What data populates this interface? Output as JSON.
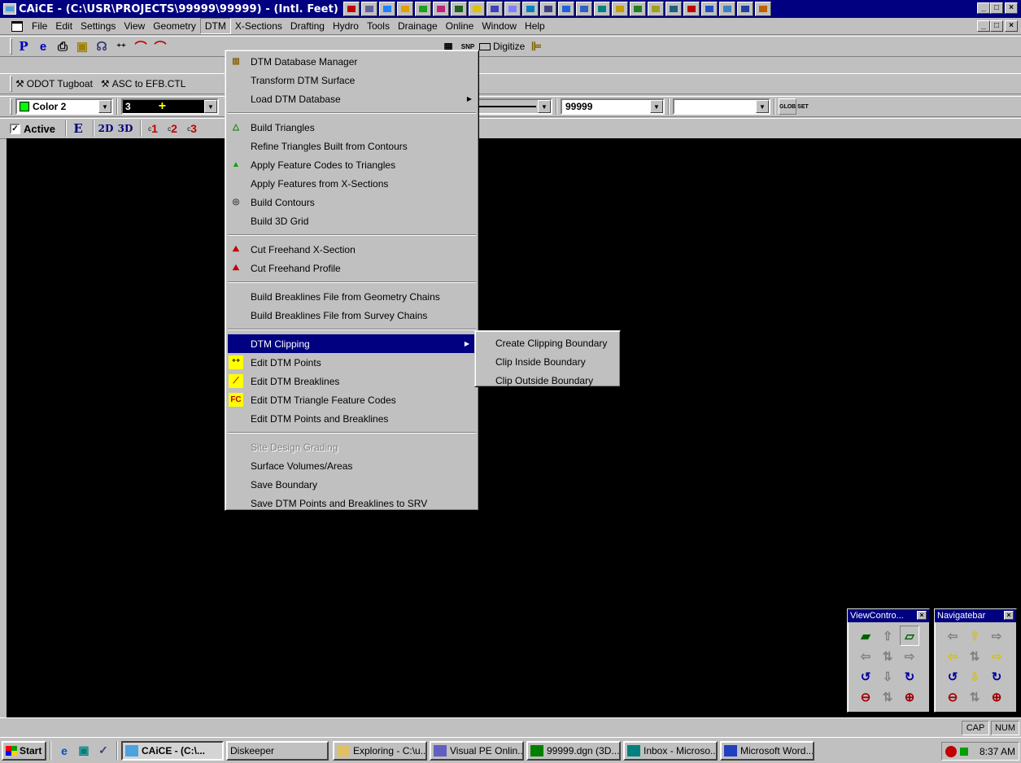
{
  "window": {
    "title": "CAiCE - (C:\\USR\\PROJECTS\\99999\\99999) - (Intl. Feet)",
    "controls": [
      "_",
      "□",
      "×"
    ]
  },
  "menubar": {
    "items": [
      "File",
      "Edit",
      "Settings",
      "View",
      "Geometry",
      "DTM",
      "X-Sections",
      "Drafting",
      "Hydro",
      "Tools",
      "Drainage",
      "Online",
      "Window",
      "Help"
    ],
    "active": "DTM"
  },
  "toolbar1": {
    "p_label": "P",
    "e_label": "e",
    "snp_label": "SNP",
    "digitize_label": "Digitize"
  },
  "toolbar2": {
    "odot_label": "ODOT Tugboat",
    "asc_label": "ASC to EFB.CTL"
  },
  "toolbar3": {
    "color_value": "Color 2",
    "weight_value": "3",
    "project_value": "99999",
    "blank_value": "",
    "glob_set_label": "GLOB SET"
  },
  "toolbar4": {
    "active_label": "Active",
    "active_checked": "✓",
    "e_label": "E",
    "view2d_label": "2D",
    "view3d_label": "3D",
    "c1_label": "1",
    "c2_label": "2",
    "c3_label": "3"
  },
  "dtm_menu": {
    "groups": [
      [
        "DTM Database Manager",
        "Transform DTM Surface",
        "Load DTM Database"
      ],
      [
        "Build Triangles",
        "Refine Triangles Built from Contours",
        "Apply Feature Codes to Triangles",
        "Apply Features from X-Sections",
        "Build Contours",
        "Build 3D Grid"
      ],
      [
        "Cut Freehand X-Section",
        "Cut Freehand Profile"
      ],
      [
        "Build Breaklines File from Geometry Chains",
        "Build Breaklines File from Survey Chains"
      ],
      [
        "DTM Clipping",
        "Edit DTM Points",
        "Edit DTM Breaklines",
        "Edit DTM Triangle Feature Codes",
        "Edit DTM Points and Breaklines"
      ],
      [
        "Site Design Grading",
        "Surface Volumes/Areas",
        "Save Boundary",
        "Save DTM Points and Breaklines to SRV"
      ]
    ],
    "highlighted": "DTM Clipping",
    "disabled": "Site Design Grading"
  },
  "clipping_submenu": {
    "items": [
      "Create Clipping Boundary",
      "Clip Inside Boundary",
      "Clip Outside Boundary"
    ]
  },
  "palettes": {
    "view_control_title": "ViewContro...",
    "navigatebar_title": "Navigatebar"
  },
  "statusbar": {
    "cap": "CAP",
    "num": "NUM"
  },
  "taskbar": {
    "start_label": "Start",
    "tasks": [
      "CAiCE - (C:\\...",
      "Diskeeper",
      "Exploring - C:\\u...",
      "Visual PE Onlin...",
      "99999.dgn (3D...",
      "Inbox - Microso...",
      "Microsoft Word..."
    ],
    "clock": "8:37 AM"
  }
}
